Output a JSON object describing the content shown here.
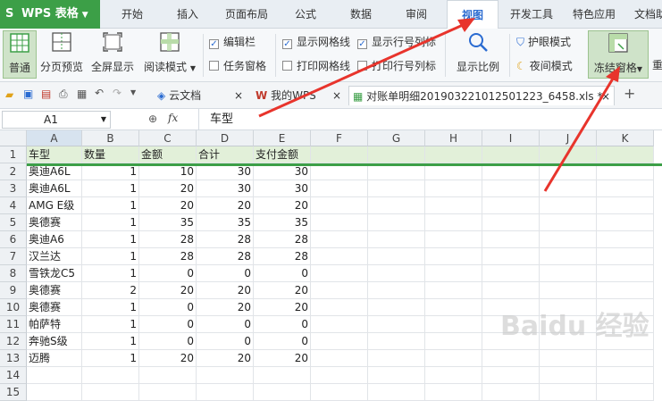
{
  "app": {
    "brand": "WPS 表格",
    "brand_color": "#3c9f47",
    "accent": "#2a6bd1"
  },
  "menu_tabs": [
    "开始",
    "插入",
    "页面布局",
    "公式",
    "数据",
    "审阅",
    "视图",
    "开发工具",
    "特色应用",
    "文档助"
  ],
  "active_tab": "视图",
  "ribbon": {
    "normal": "普通",
    "page_break_preview": "分页预览",
    "full_screen": "全屏显示",
    "reading_mode": "阅读模式",
    "edit_bar": "编辑栏",
    "task_pane": "任务窗格",
    "show_gridlines": "显示网格线",
    "show_headers": "显示行号列标",
    "print_gridlines": "打印网格线",
    "print_headers": "打印行号列标",
    "zoom": "显示比例",
    "eye_mode": "护眼模式",
    "night_mode": "夜间模式",
    "freeze_panes": "冻结窗格",
    "rearrange": "重"
  },
  "doc_tabs": {
    "cloud": "云文档",
    "mywps": "我的WPS",
    "file": "对账单明细201903221012501223_6458.xls *"
  },
  "formula": {
    "cell_ref": "A1",
    "fx": "fx",
    "value": "车型"
  },
  "columns": [
    "A",
    "B",
    "C",
    "D",
    "E",
    "F",
    "G",
    "H",
    "I",
    "J",
    "K"
  ],
  "rows": [
    [
      "车型",
      "数量",
      "金额",
      "合计",
      "支付金额"
    ],
    [
      "奥迪A6L",
      "1",
      "10",
      "30",
      "30"
    ],
    [
      "奥迪A6L",
      "1",
      "20",
      "30",
      "30"
    ],
    [
      "AMG E级",
      "1",
      "20",
      "20",
      "20"
    ],
    [
      "奥德赛",
      "1",
      "35",
      "35",
      "35"
    ],
    [
      "奥迪A6",
      "1",
      "28",
      "28",
      "28"
    ],
    [
      "汉兰达",
      "1",
      "28",
      "28",
      "28"
    ],
    [
      "雪铁龙C5",
      "1",
      "0",
      "0",
      "0"
    ],
    [
      "奥德赛",
      "2",
      "20",
      "20",
      "20"
    ],
    [
      "奥德赛",
      "1",
      "0",
      "20",
      "20"
    ],
    [
      "帕萨特",
      "1",
      "0",
      "0",
      "0"
    ],
    [
      "奔驰S级",
      "1",
      "0",
      "0",
      "0"
    ],
    [
      "迈腾",
      "1",
      "20",
      "20",
      "20"
    ]
  ],
  "extra_row_numbers": [
    "14",
    "15"
  ],
  "watermark": "Baidu 经验"
}
